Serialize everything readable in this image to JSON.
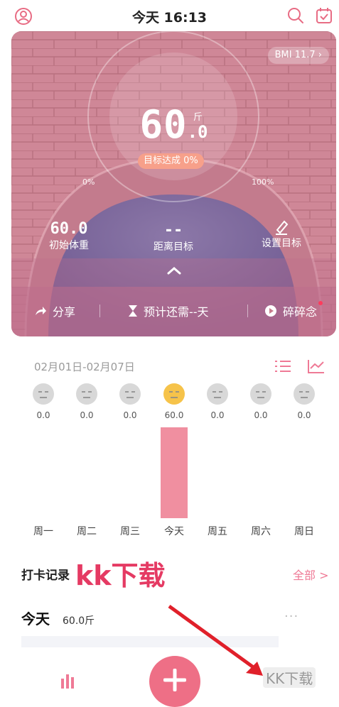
{
  "header": {
    "title": "今天 16:13"
  },
  "hero": {
    "bmi_label": "BMI 11.7",
    "weight_int": "60",
    "weight_dec": "0",
    "weight_unit": "斤",
    "goal_progress_label": "目标达成 0%",
    "range_min_label": "0%",
    "range_max_label": "100%",
    "stats": [
      {
        "value": "60.0",
        "label": "初始体重"
      },
      {
        "value": "--",
        "label": "距离目标"
      },
      {
        "value": "",
        "label": "设置目标"
      }
    ],
    "actions": [
      {
        "label": "分享"
      },
      {
        "label": "预计还需--天"
      },
      {
        "label": "碎碎念"
      }
    ]
  },
  "week": {
    "date_range": "02月01日-02月07日",
    "days": [
      {
        "value": "0.0",
        "label": "周一"
      },
      {
        "value": "0.0",
        "label": "周二"
      },
      {
        "value": "0.0",
        "label": "周三"
      },
      {
        "value": "60.0",
        "label": "今天"
      },
      {
        "value": "0.0",
        "label": "周五"
      },
      {
        "value": "0.0",
        "label": "周六"
      },
      {
        "value": "0.0",
        "label": "周日"
      }
    ]
  },
  "records": {
    "title": "打卡记录",
    "watermark": "kk下载",
    "all_label": "全部 >",
    "today_label": "今天",
    "today_value": "60.0斤"
  },
  "bottom": {
    "corner_watermark": "KK下载"
  },
  "colors": {
    "accent_pink": "#ee6f86",
    "bar_pink": "#f08fa0",
    "badge_orange": "#f7a08a"
  }
}
